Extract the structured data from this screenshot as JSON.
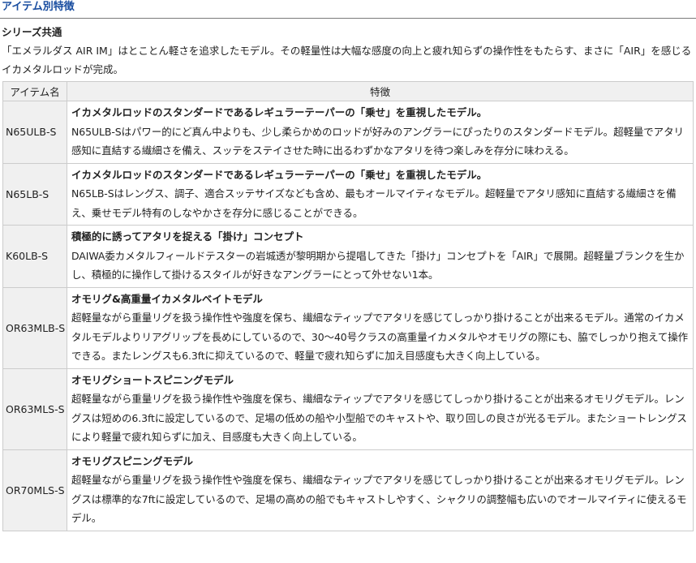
{
  "header": {
    "title": "アイテム別特徴"
  },
  "series": {
    "title": "シリーズ共通",
    "description": "「エメラルダス AIR IM」はとことん軽さを追求したモデル。その軽量性は大幅な感度の向上と疲れ知らずの操作性をもたらす、まさに「AIR」を感じるイカメタルロッドが完成。"
  },
  "table": {
    "headers": {
      "item": "アイテム名",
      "feature": "特徴"
    },
    "rows": [
      {
        "name": "N65ULB-S",
        "feature_title": "イカメタルロッドのスタンダードであるレギュラーテーパーの「乗せ」を重視したモデル。",
        "feature_body": "N65ULB-Sはパワー的にど真ん中よりも、少し柔らかめのロッドが好みのアングラーにぴったりのスタンダードモデル。超軽量でアタリ感知に直結する繊細さを備え、スッテをステイさせた時に出るわずかなアタリを待つ楽しみを存分に味わえる。"
      },
      {
        "name": "N65LB-S",
        "feature_title": "イカメタルロッドのスタンダードであるレギュラーテーパーの「乗せ」を重視したモデル。",
        "feature_body": "N65LB-Sはレングス、調子、適合スッテサイズなども含め、最もオールマイティなモデル。超軽量でアタリ感知に直結する繊細さを備え、乗せモデル特有のしなやかさを存分に感じることができる。"
      },
      {
        "name": "K60LB-S",
        "feature_title": "積極的に誘ってアタリを捉える「掛け」コンセプト",
        "feature_body": "DAIWA委カメタルフィールドテスターの岩城透が黎明期から提唱してきた「掛け」コンセプトを「AIR」で展開。超軽量ブランクを生かし、積極的に操作して掛けるスタイルが好きなアングラーにとって外せない1本。"
      },
      {
        "name": "OR63MLB-S",
        "feature_title": "オモリグ&高重量イカメタルベイトモデル",
        "feature_body": "超軽量ながら重量リグを扱う操作性や強度を保ち、繊細なティップでアタリを感じてしっかり掛けることが出来るモデル。通常のイカメタルモデルよりリアグリップを長めにしているので、30～40号クラスの高重量イカメタルやオモリグの際にも、脇でしっかり抱えて操作できる。またレングスも6.3ftに抑えているので、軽量で疲れ知らずに加え目感度も大きく向上している。"
      },
      {
        "name": "OR63MLS-S",
        "feature_title": "オモリグショートスピニングモデル",
        "feature_body": "超軽量ながら重量リグを扱う操作性や強度を保ち、繊細なティップでアタリを感じてしっかり掛けることが出来るオモリグモデル。レングスは短めの6.3ftに設定しているので、足場の低めの船や小型船でのキャストや、取り回しの良さが光るモデル。またショートレングスにより軽量で疲れ知らずに加え、目感度も大きく向上している。"
      },
      {
        "name": "OR70MLS-S",
        "feature_title": "オモリグスピニングモデル",
        "feature_body": "超軽量ながら重量リグを扱う操作性や強度を保ち、繊細なティップでアタリを感じてしっかり掛けることが出来るオモリグモデル。レングスは標準的な7ftに設定しているので、足場の高めの船でもキャストしやすく、シャクリの調整幅も広いのでオールマイティに使えるモデル。"
      }
    ]
  },
  "colors": {
    "accent": "#1a4ea0",
    "header_bg": "#f0f0f0",
    "border": "#cccccc"
  }
}
